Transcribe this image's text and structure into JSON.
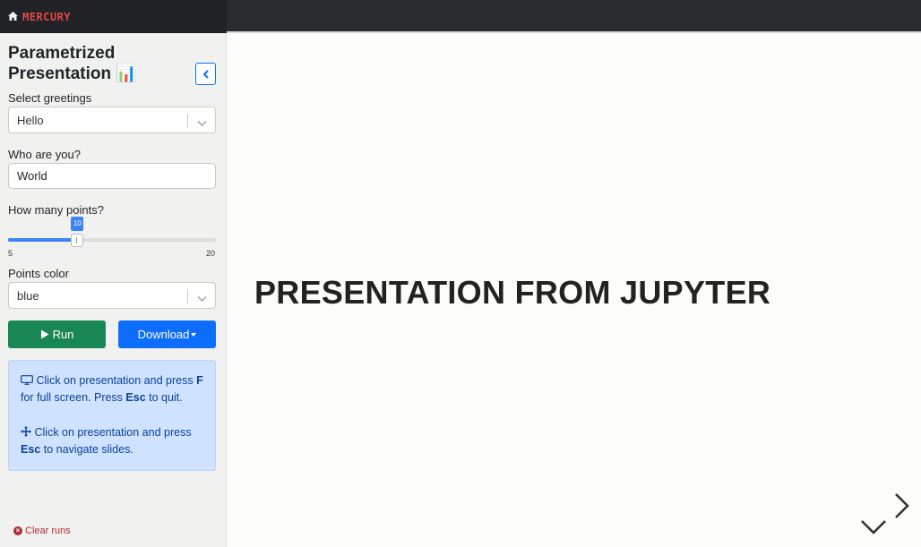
{
  "app": {
    "brand": "MERCURY"
  },
  "sidebar": {
    "title": "Parametrized Presentation 📊",
    "greetings": {
      "label": "Select greetings",
      "value": "Hello"
    },
    "name": {
      "label": "Who are you?",
      "value": "World"
    },
    "points": {
      "label": "How many points?",
      "value": 10,
      "min": "5",
      "max": "20",
      "value_label": "10"
    },
    "color": {
      "label": "Points color",
      "value": "blue"
    },
    "run_label": "Run",
    "download_label": "Download",
    "info": {
      "line1_a": "Click on presentation and press",
      "line1_key": "F",
      "line1_b": "for full screen. Press",
      "line1_key2": "Esc",
      "line1_c": "to quit.",
      "line2_a": "Click on presentation and press",
      "line2_key": "Esc",
      "line2_b": "to navigate slides."
    },
    "clear_runs": "Clear runs"
  },
  "slide": {
    "title": "PRESENTATION FROM JUPYTER"
  },
  "colors": {
    "run": "#198754",
    "download": "#0d6efd",
    "info_bg": "#cfe2ff",
    "brand": "#e0474c"
  },
  "icons": [
    "home-icon",
    "chevron-left-icon",
    "chevron-down-icon",
    "play-icon",
    "caret-down-icon",
    "monitor-icon",
    "move-arrows-icon",
    "x-circle-icon",
    "arrow-right-icon",
    "arrow-down-icon"
  ]
}
